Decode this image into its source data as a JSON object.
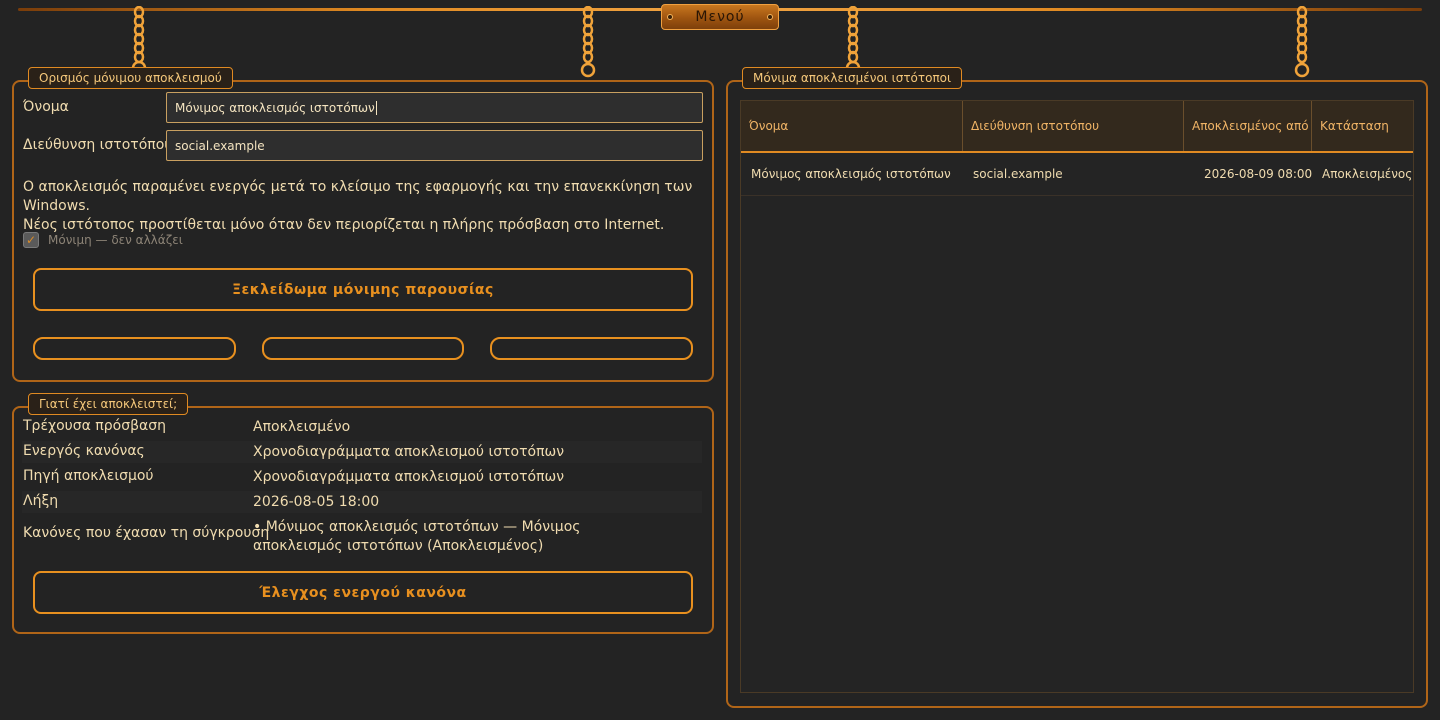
{
  "menu": {
    "label": "Μενού"
  },
  "definition": {
    "legend": "Ορισμός μόνιμου αποκλεισμού",
    "name_label": "Όνομα",
    "name_value": "Μόνιμος αποκλεισμός ιστοτόπων",
    "address_label": "Διεύθυνση ιστοτόπου",
    "address_value": "social.example",
    "notice_line1": "Ο αποκλεισμός παραμένει ενεργός μετά το κλείσιμο της εφαρμογής και την επανεκκίνηση των Windows.",
    "notice_line2": "Νέος ιστότοπος προστίθεται μόνο όταν δεν περιορίζεται η πλήρης πρόσβαση στο Internet.",
    "checkbox_label": "Μόνιμη — δεν αλλάζει",
    "checkbox_checked": true,
    "unlock_button": "Ξεκλείδωμα μόνιμης παρουσίας"
  },
  "why": {
    "legend": "Γιατί έχει αποκλειστεί;",
    "rows": [
      {
        "label": "Τρέχουσα πρόσβαση",
        "value": "Αποκλεισμένο"
      },
      {
        "label": "Ενεργός κανόνας",
        "value": "Χρονοδιαγράμματα αποκλεισμού ιστοτόπων"
      },
      {
        "label": "Πηγή αποκλεισμού",
        "value": "Χρονοδιαγράμματα αποκλεισμού ιστοτόπων"
      },
      {
        "label": "Λήξη",
        "value": "2026-08-05 18:00"
      },
      {
        "label": "Κανόνες που έχασαν τη σύγκρουση",
        "value": "• Μόνιμος αποκλεισμός ιστοτόπων — Μόνιμος αποκλεισμός ιστοτόπων (Αποκλεισμένος)"
      }
    ],
    "check_button": "Έλεγχος ενεργού κανόνα"
  },
  "blocked_sites": {
    "legend": "Μόνιμα αποκλεισμένοι ιστότοποι",
    "columns": [
      "Όνομα",
      "Διεύθυνση ιστοτόπου",
      "Αποκλεισμένος από",
      "Κατάσταση"
    ],
    "rows": [
      {
        "name": "Μόνιμος αποκλεισμός ιστοτόπων",
        "address": "social.example",
        "blocked_from": "2026-08-09 08:00",
        "status": "Αποκλεισμένος"
      }
    ]
  }
}
